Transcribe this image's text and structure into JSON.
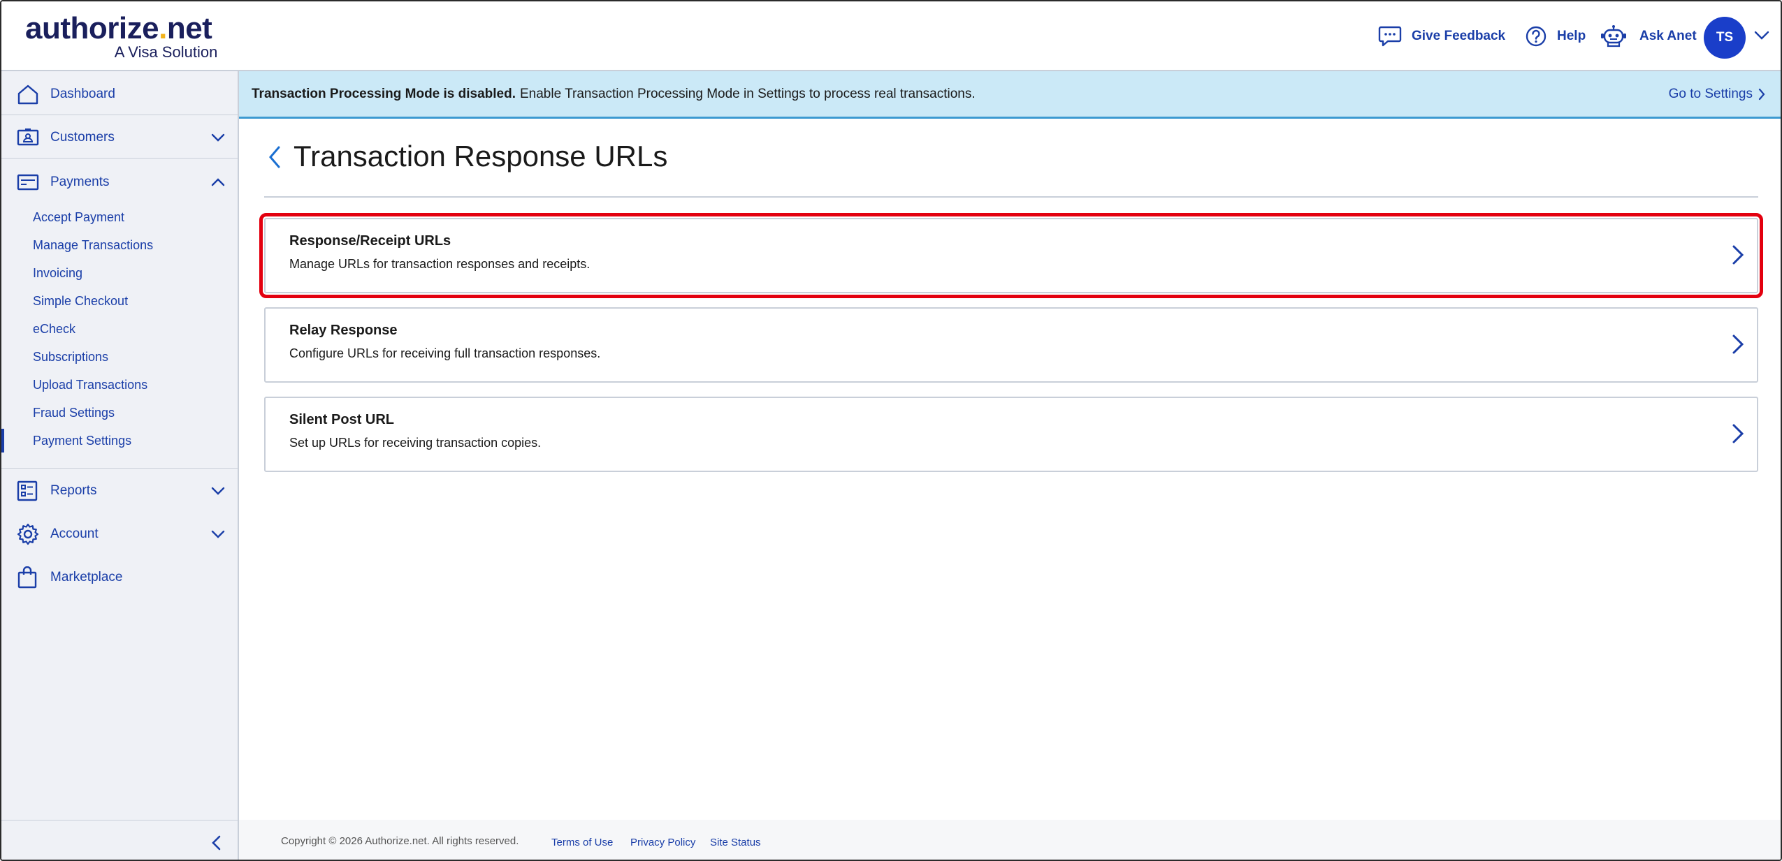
{
  "header": {
    "logo_main_a": "authorize",
    "logo_dot": ".",
    "logo_main_b": "net",
    "logo_sub": "A Visa Solution",
    "feedback_label": "Give Feedback",
    "help_label": "Help",
    "ask_label": "Ask Anet",
    "avatar_initials": "TS"
  },
  "sidebar": {
    "dashboard": "Dashboard",
    "customers": "Customers",
    "payments": "Payments",
    "payments_items": [
      "Accept Payment",
      "Manage Transactions",
      "Invoicing",
      "Simple Checkout",
      "eCheck",
      "Subscriptions",
      "Upload Transactions",
      "Fraud Settings",
      "Payment Settings"
    ],
    "active_item": "Payment Settings",
    "reports": "Reports",
    "account": "Account",
    "marketplace": "Marketplace"
  },
  "banner": {
    "bold_text": "Transaction Processing Mode is disabled.",
    "text": "Enable Transaction Processing Mode in Settings to process real transactions.",
    "link": "Go to Settings"
  },
  "main": {
    "title": "Transaction Response URLs",
    "cards": [
      {
        "title": "Response/Receipt URLs",
        "desc": "Manage URLs for transaction responses and receipts.",
        "highlighted": true
      },
      {
        "title": "Relay Response",
        "desc": "Configure URLs for receiving full transaction responses.",
        "highlighted": false
      },
      {
        "title": "Silent Post URL",
        "desc": "Set up URLs for receiving transaction copies.",
        "highlighted": false
      }
    ]
  },
  "footer": {
    "copyright": "Copyright © 2026 Authorize.net. All rights reserved.",
    "terms": "Terms of Use",
    "privacy": "Privacy Policy",
    "status": "Site Status"
  },
  "colors": {
    "brand_blue": "#1a3ea8",
    "banner_bg": "#cbe9f7",
    "highlight": "#e3000f",
    "avatar": "#1a3ec9"
  }
}
